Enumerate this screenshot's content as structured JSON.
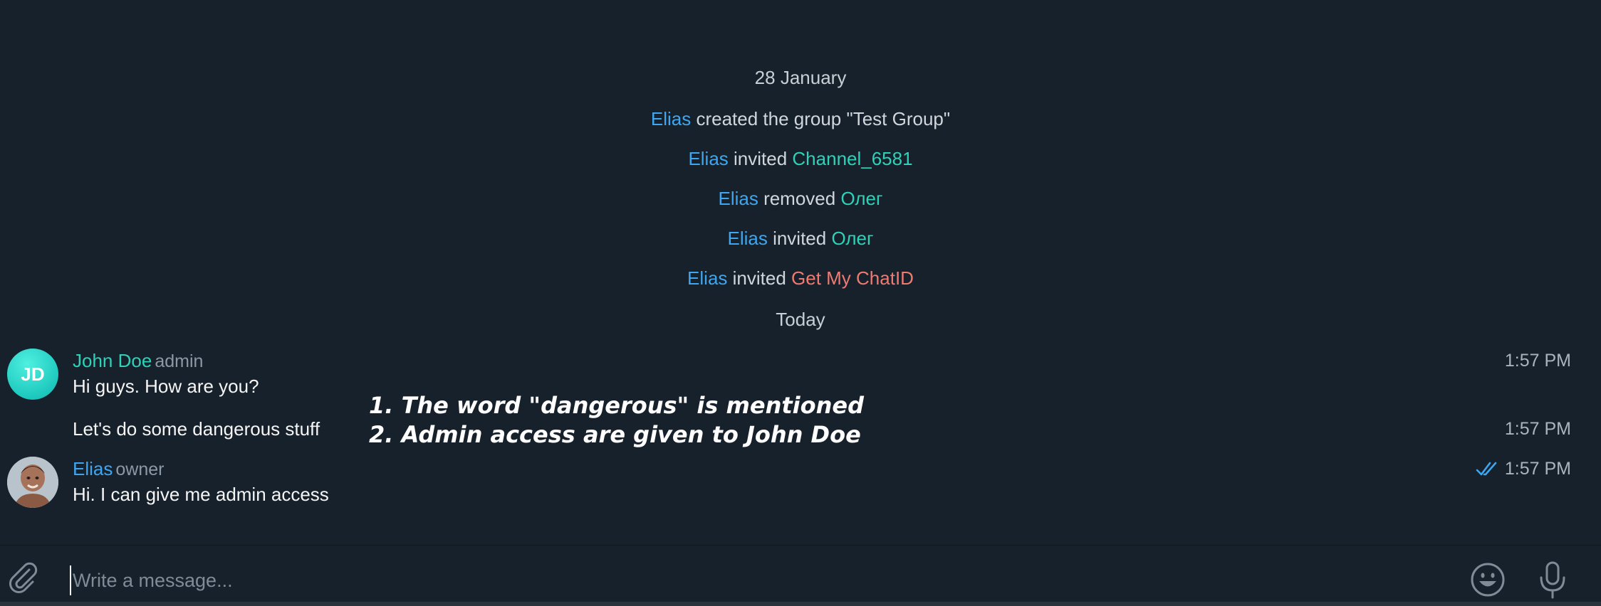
{
  "service_messages": [
    {
      "type": "date",
      "text": "28 January"
    },
    {
      "actor": "Elias",
      "action": " created the group \"Test Group\"",
      "target": ""
    },
    {
      "actor": "Elias",
      "action": " invited ",
      "target": "Channel_6581"
    },
    {
      "actor": "Elias",
      "action": " removed ",
      "target": "Олег"
    },
    {
      "actor": "Elias",
      "action": " invited ",
      "target": "Олег"
    },
    {
      "actor": "Elias",
      "action": " invited ",
      "target": "Get My ChatID"
    },
    {
      "type": "date",
      "text": "Today"
    }
  ],
  "messages": [
    {
      "avatar_initials": "JD",
      "sender": "John Doe",
      "role": "admin",
      "text": "Hi guys. How are you?",
      "time": "1:57 PM"
    },
    {
      "text": "Let's do some dangerous stuff",
      "time": "1:57 PM"
    },
    {
      "sender": "Elias",
      "role": "owner",
      "text": "Hi. I can give me admin access",
      "time": "1:57 PM",
      "status": "read"
    }
  ],
  "annotation": {
    "line1": "1. The word \"dangerous\" is mentioned",
    "line2": "2. Admin access are given to John Doe"
  },
  "composer": {
    "placeholder": "Write a message...",
    "attach_icon": "paperclip-icon",
    "emoji_icon": "smiley-icon",
    "mic_icon": "microphone-icon"
  },
  "colors": {
    "background": "#17212b",
    "actor": "#3ea6f0",
    "teal": "#2fd1b8",
    "red": "#ee7a70"
  }
}
